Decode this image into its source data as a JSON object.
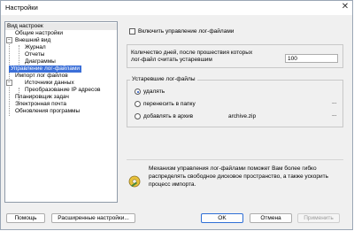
{
  "window": {
    "title": "Настройки",
    "close_glyph": "✕"
  },
  "tree": {
    "items": [
      {
        "label": "Вид настроек"
      },
      {
        "label": "Общие настройки"
      },
      {
        "label": "Внешний вид"
      },
      {
        "label": "Журнал"
      },
      {
        "label": "Отчеты"
      },
      {
        "label": "Диаграммы"
      },
      {
        "label": "Управление лог-файлами"
      },
      {
        "label": "Импорт лог файлов"
      },
      {
        "label": "Источники данных"
      },
      {
        "label": "Преобразование IP адресов"
      },
      {
        "label": "Планировщик задач"
      },
      {
        "label": "Электронная почта"
      },
      {
        "label": "Обновления программы"
      }
    ],
    "expander_minus": "−"
  },
  "panel": {
    "enable_checkbox_label": "Включить управление лог-файлами",
    "days_label_line1": "Количество дней, после прошествия которых",
    "days_label_line2": "лог-файл считать устаревшим",
    "days_value": "100",
    "group_title": "Устаревшие лог-файлы",
    "option_delete": "удалять",
    "option_move": "перенесить в папку",
    "option_archive": "добавлять в архив",
    "archive_value": "archive.zip",
    "browse_label": "...",
    "info_line1": "Механизм управления лог-файлами поможет Вам более гибко",
    "info_line2": "распределять свободное дисковое пространство, а также ускорить",
    "info_line3": "процесс импорта.",
    "info_icon": "wrench-gear-icon"
  },
  "buttons": {
    "help": "Помощь",
    "advanced": "Расширенные настройки...",
    "ok": "OK",
    "cancel": "Отмена",
    "apply": "Применить"
  }
}
